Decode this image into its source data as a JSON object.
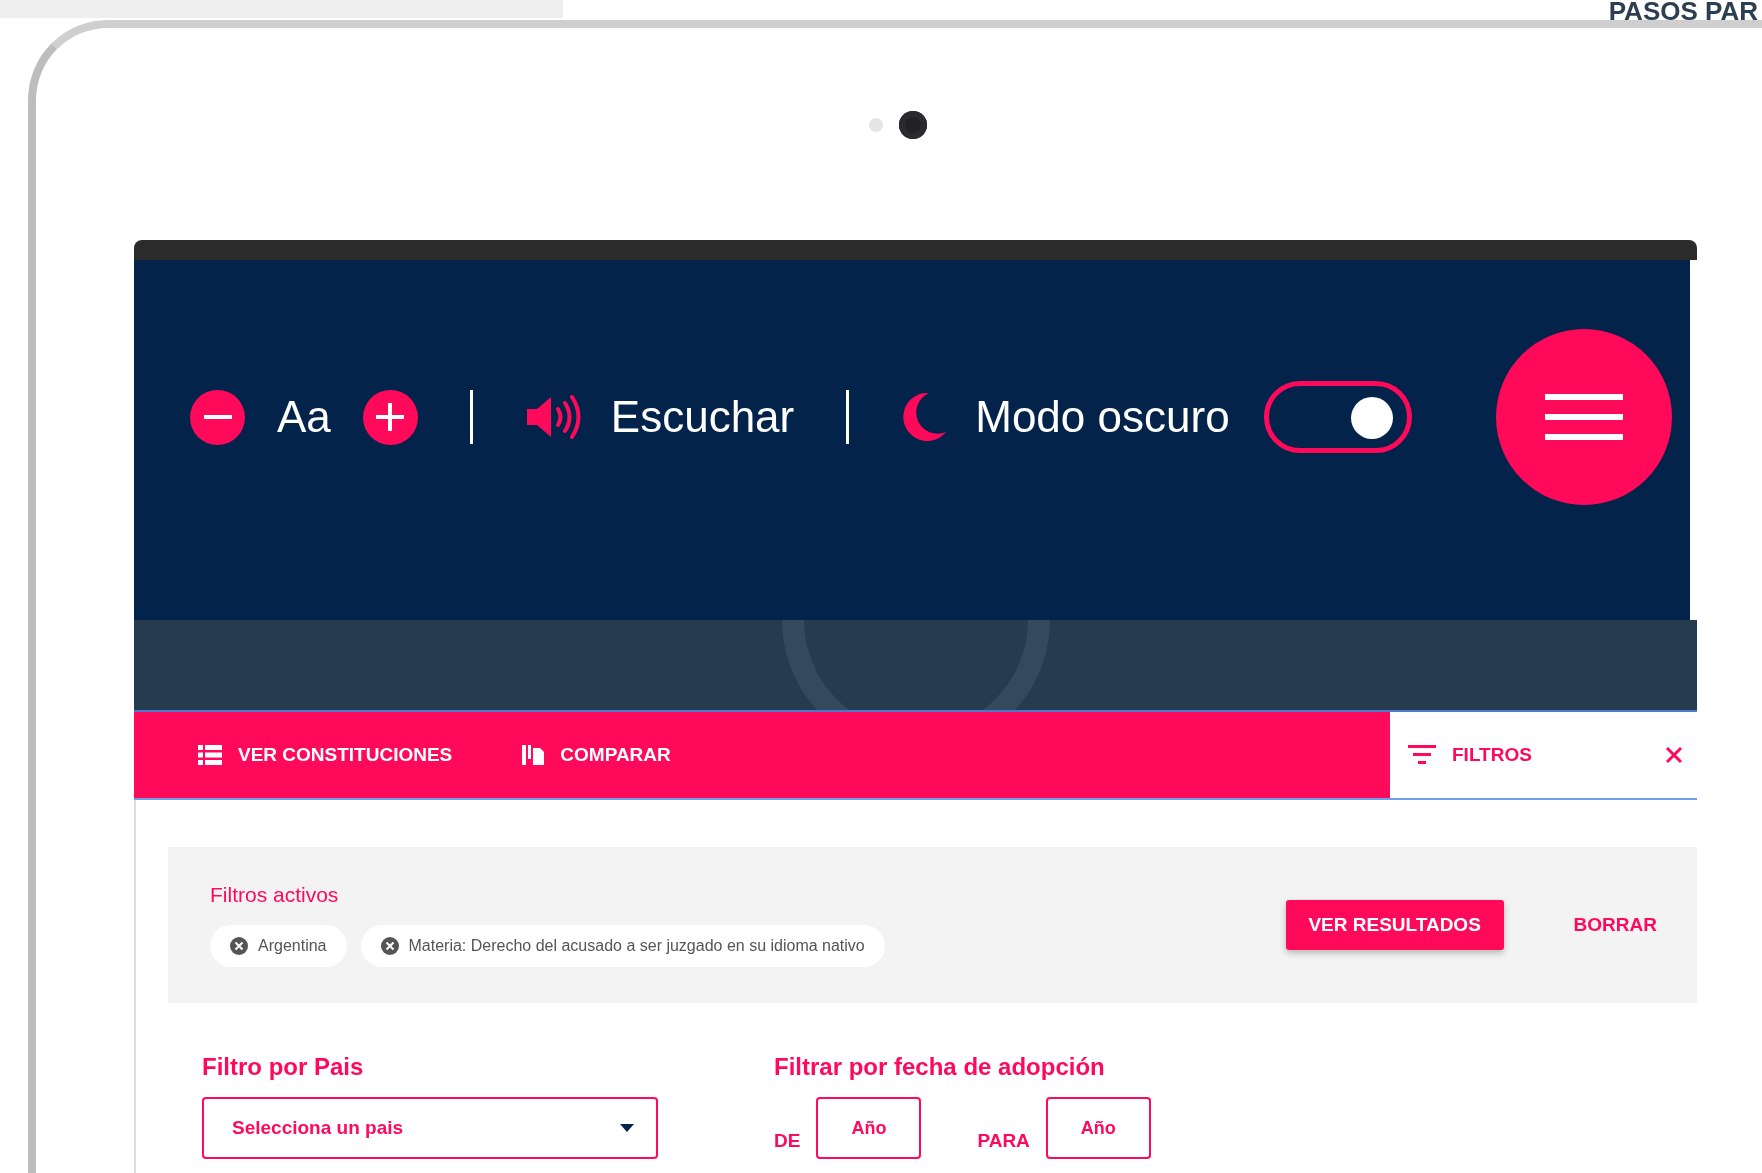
{
  "corner_heading": "PASOS PAR",
  "toolbar": {
    "font_label": "Aa",
    "listen_label": "Escuchar",
    "dark_mode_label": "Modo oscuro",
    "dark_mode_on": true
  },
  "nav": {
    "tabs": [
      {
        "label": "VER CONSTITUCIONES",
        "kind": "list"
      },
      {
        "label": "COMPARAR",
        "kind": "compare"
      }
    ],
    "filters_panel": {
      "label": "FILTROS",
      "open": true
    }
  },
  "active_filters": {
    "title": "Filtros activos",
    "chips": [
      "Argentina",
      "Materia: Derecho del acusado a ser juzgado en su idioma nativo"
    ],
    "apply_button": "VER RESULTADOS",
    "clear_button": "BORRAR"
  },
  "country_filter": {
    "title": "Filtro por Pais",
    "placeholder": "Selecciona un pais"
  },
  "date_filter": {
    "title": "Filtrar por fecha de adopción",
    "from_label": "DE",
    "from_placeholder": "Año",
    "to_label": "PARA",
    "to_placeholder": "Año"
  }
}
